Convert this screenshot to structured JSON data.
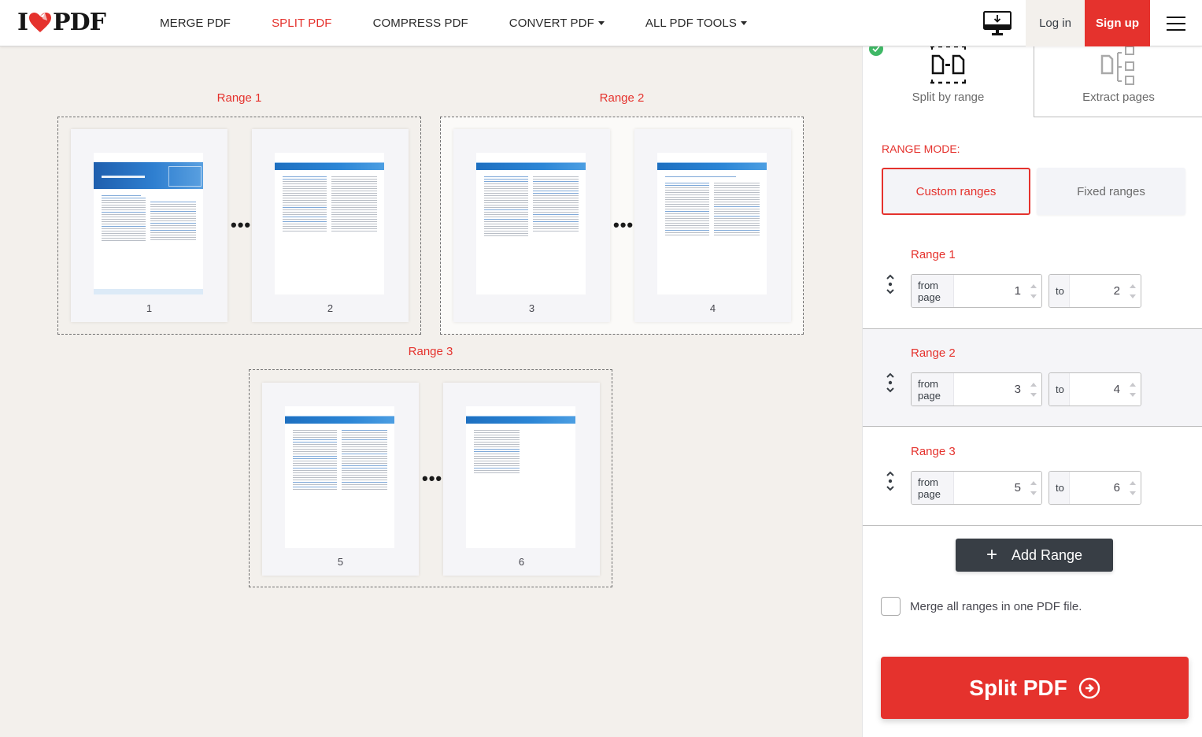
{
  "brand": {
    "logo_left": "I",
    "logo_right": "PDF",
    "accent_color": "#e5322d",
    "dark_color": "#383e45"
  },
  "nav": {
    "items": [
      {
        "label": "MERGE PDF",
        "active": false,
        "dropdown": false
      },
      {
        "label": "SPLIT PDF",
        "active": true,
        "dropdown": false
      },
      {
        "label": "COMPRESS PDF",
        "active": false,
        "dropdown": false
      },
      {
        "label": "CONVERT PDF",
        "active": false,
        "dropdown": true
      },
      {
        "label": "ALL PDF TOOLS",
        "active": false,
        "dropdown": true
      }
    ],
    "desktop_icon": "desktop-download-icon",
    "login_label": "Log in",
    "signup_label": "Sign up",
    "menu_icon": "hamburger-menu-icon"
  },
  "workspace": {
    "ranges": [
      {
        "label": "Range 1",
        "pages": [
          "1",
          "2"
        ],
        "separator": "•••"
      },
      {
        "label": "Range 2",
        "pages": [
          "3",
          "4"
        ],
        "separator": "•••"
      },
      {
        "label": "Range 3",
        "pages": [
          "5",
          "6"
        ],
        "separator": "•••"
      }
    ]
  },
  "sidebar": {
    "modes": [
      {
        "label": "Split by range",
        "icon": "split-by-range-icon",
        "selected": true
      },
      {
        "label": "Extract pages",
        "icon": "extract-pages-icon",
        "selected": false
      }
    ],
    "range_mode_title": "RANGE MODE:",
    "range_mode_options": [
      {
        "label": "Custom ranges",
        "selected": true
      },
      {
        "label": "Fixed ranges",
        "selected": false
      }
    ],
    "ranges": [
      {
        "title": "Range 1",
        "from_label": "from page",
        "from_value": "1",
        "to_label": "to",
        "to_value": "2"
      },
      {
        "title": "Range 2",
        "from_label": "from page",
        "from_value": "3",
        "to_label": "to",
        "to_value": "4"
      },
      {
        "title": "Range 3",
        "from_label": "from page",
        "from_value": "5",
        "to_label": "to",
        "to_value": "6"
      }
    ],
    "add_range_label": "Add Range",
    "add_range_icon": "+",
    "merge_label": "Merge all ranges in one PDF file.",
    "merge_checked": false,
    "split_button_label": "Split PDF"
  }
}
